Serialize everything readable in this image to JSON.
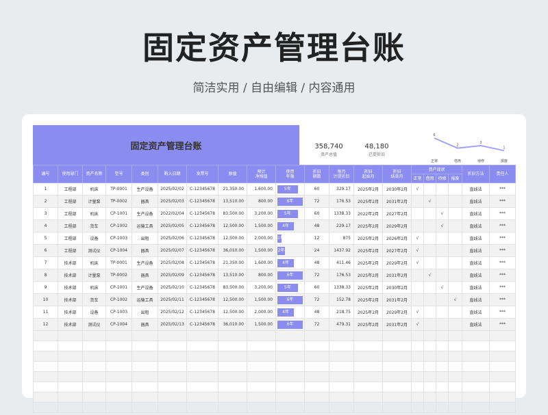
{
  "page": {
    "title": "固定资产管理台账",
    "subtitle": "简洁实用 / 自由编辑 / 内容通用"
  },
  "sheet": {
    "banner_title": "固定资产管理台账",
    "stats": [
      {
        "value": "358,740",
        "label": "资产总值"
      },
      {
        "value": "48,180",
        "label": "已提折旧"
      }
    ],
    "status_chart": {
      "categories": [
        "正常",
        "借用",
        "待修",
        "报废"
      ],
      "values": [
        6,
        2,
        3,
        1
      ]
    },
    "headers": {
      "no": "编号",
      "dept": "使用部门",
      "name": "资产名称",
      "model": "型号",
      "category": "类别",
      "date": "购入日期",
      "invoice": "发票号",
      "value": "原值",
      "residual_1": "预计",
      "residual_2": "净残值",
      "life_1": "使用",
      "life_2": "年限",
      "dep_1": "折旧",
      "dep_2": "期数",
      "monthly_1": "每月",
      "monthly_2": "计提折旧",
      "start_1": "折旧",
      "start_2": "起始月",
      "end_1": "折旧",
      "end_2": "结束月",
      "status": "资产现状",
      "status_normal": "正常",
      "status_borrow": "借用",
      "status_repair": "待修",
      "status_scrap": "报废",
      "method": "折旧方法",
      "owner": "责任人"
    },
    "rows": [
      {
        "no": "1",
        "dept": "工程部",
        "name": "机床",
        "model": "TP-0001",
        "category": "生产设备",
        "date": "2025/02/02",
        "invoice": "C-12345678",
        "value": "21,350.00",
        "residual": "1,600.00",
        "life": "5年",
        "life_frac": 0.8,
        "periods": "60",
        "monthly": "329.17",
        "start": "2025年2月",
        "end": "2030年2月",
        "normal": "√",
        "borrow": "",
        "repair": "",
        "scrap": "",
        "method": "直线法",
        "owner": "***"
      },
      {
        "no": "2",
        "dept": "工程部",
        "name": "计量泵",
        "model": "TP-0002",
        "category": "器具",
        "date": "2025/02/03",
        "invoice": "C-12345678",
        "value": "13,510.00",
        "residual": "800.00",
        "life": "6年",
        "life_frac": 1,
        "periods": "72",
        "monthly": "176.53",
        "start": "2025年2月",
        "end": "2031年2月",
        "normal": "",
        "borrow": "√",
        "repair": "",
        "scrap": "",
        "method": "直线法",
        "owner": "***"
      },
      {
        "no": "3",
        "dept": "工程部",
        "name": "机床",
        "model": "CP-1001",
        "category": "生产设备",
        "date": "2022/02/04",
        "invoice": "C-12345678",
        "value": "83,500.00",
        "residual": "3,200.00",
        "life": "5年",
        "life_frac": 0.8,
        "periods": "60",
        "monthly": "1338.33",
        "start": "2022年2月",
        "end": "2027年2月",
        "normal": "",
        "borrow": "",
        "repair": "√",
        "scrap": "",
        "method": "直线法",
        "owner": "***"
      },
      {
        "no": "4",
        "dept": "工程部",
        "name": "货车",
        "model": "CP-1002",
        "category": "运输工具",
        "date": "2025/02/05",
        "invoice": "C-12345678",
        "value": "12,500.00",
        "residual": "1,500.00",
        "life": "4年",
        "life_frac": 0.65,
        "periods": "48",
        "monthly": "229.17",
        "start": "2025年2月",
        "end": "2029年2月",
        "normal": "",
        "borrow": "",
        "repair": "√",
        "scrap": "",
        "method": "直线法",
        "owner": "***"
      },
      {
        "no": "5",
        "dept": "工程部",
        "name": "设备",
        "model": "CP-1003",
        "category": "出租",
        "date": "2025/02/06",
        "invoice": "C-12345678",
        "value": "12,500.00",
        "residual": "2,000.00",
        "life": "1年",
        "life_frac": 0.15,
        "periods": "12",
        "monthly": "875",
        "start": "2025年2月",
        "end": "2026年2月",
        "normal": "√",
        "borrow": "",
        "repair": "",
        "scrap": "",
        "method": "直线法",
        "owner": "***"
      },
      {
        "no": "6",
        "dept": "工程部",
        "name": "测试仪",
        "model": "CP-1004",
        "category": "器具",
        "date": "2025/02/07",
        "invoice": "C-12345678",
        "value": "36,010.00",
        "residual": "1,500.00",
        "life": "2年",
        "life_frac": 0.3,
        "periods": "24",
        "monthly": "1437.92",
        "start": "2025年2月",
        "end": "2027年2月",
        "normal": "√",
        "borrow": "",
        "repair": "",
        "scrap": "",
        "method": "直线法",
        "owner": "***"
      },
      {
        "no": "7",
        "dept": "技术部",
        "name": "机床",
        "model": "TP-0001",
        "category": "生产设备",
        "date": "2025/02/08",
        "invoice": "C-12345678",
        "value": "21,350.00",
        "residual": "1,600.00",
        "life": "4年",
        "life_frac": 0.65,
        "periods": "48",
        "monthly": "411.46",
        "start": "2025年2月",
        "end": "2029年2月",
        "normal": "√",
        "borrow": "",
        "repair": "",
        "scrap": "",
        "method": "直线法",
        "owner": "***"
      },
      {
        "no": "8",
        "dept": "技术部",
        "name": "计量泵",
        "model": "TP-0002",
        "category": "器具",
        "date": "2025/02/09",
        "invoice": "C-12345678",
        "value": "13,510.00",
        "residual": "800.00",
        "life": "6年",
        "life_frac": 1,
        "periods": "72",
        "monthly": "176.53",
        "start": "2025年2月",
        "end": "2031年2月",
        "normal": "",
        "borrow": "√",
        "repair": "",
        "scrap": "",
        "method": "直线法",
        "owner": "***"
      },
      {
        "no": "9",
        "dept": "技术部",
        "name": "机床",
        "model": "CP-1001",
        "category": "生产设备",
        "date": "2025/02/10",
        "invoice": "C-12345678",
        "value": "83,500.00",
        "residual": "3,200.00",
        "life": "5年",
        "life_frac": 0.8,
        "periods": "60",
        "monthly": "1338.33",
        "start": "2025年2月",
        "end": "2030年2月",
        "normal": "",
        "borrow": "",
        "repair": "√",
        "scrap": "",
        "method": "直线法",
        "owner": "***"
      },
      {
        "no": "10",
        "dept": "技术部",
        "name": "货车",
        "model": "CP-1002",
        "category": "运输工具",
        "date": "2025/02/11",
        "invoice": "C-12345678",
        "value": "12,500.00",
        "residual": "1,500.00",
        "life": "6年",
        "life_frac": 1,
        "periods": "72",
        "monthly": "152.78",
        "start": "2025年2月",
        "end": "2031年2月",
        "normal": "",
        "borrow": "",
        "repair": "",
        "scrap": "√",
        "method": "直线法",
        "owner": "***"
      },
      {
        "no": "11",
        "dept": "技术部",
        "name": "设备",
        "model": "CP-1003",
        "category": "出租",
        "date": "2025/02/12",
        "invoice": "C-12345678",
        "value": "12,500.00",
        "residual": "2,000.00",
        "life": "4年",
        "life_frac": 0.65,
        "periods": "48",
        "monthly": "218.75",
        "start": "2025年2月",
        "end": "2029年2月",
        "normal": "√",
        "borrow": "",
        "repair": "",
        "scrap": "",
        "method": "直线法",
        "owner": "***"
      },
      {
        "no": "12",
        "dept": "技术部",
        "name": "测试仪",
        "model": "CP-1004",
        "category": "器具",
        "date": "2025/02/13",
        "invoice": "C-12345678",
        "value": "36,010.00",
        "residual": "1,500.00",
        "life": "6年",
        "life_frac": 1,
        "periods": "72",
        "monthly": "479.31",
        "start": "2025年2月",
        "end": "2031年2月",
        "normal": "√",
        "borrow": "",
        "repair": "",
        "scrap": "",
        "method": "直线法",
        "owner": "***"
      }
    ]
  },
  "colors": {
    "accent": "#8b8cf0"
  }
}
